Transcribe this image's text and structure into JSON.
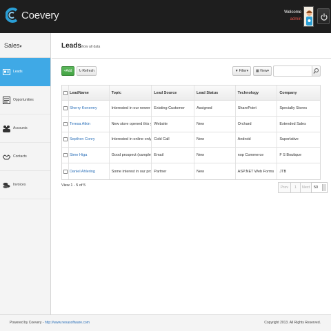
{
  "header": {
    "brand": "Coevery",
    "welcome_label": "Welcome",
    "username": "admin",
    "colors": {
      "background": "#1e1e1e",
      "logo_accent": "#2a9fd6",
      "username": "#e8574c"
    }
  },
  "sidebar": {
    "app_selector": "Sales",
    "items": [
      {
        "label": "Leads",
        "icon": "leads-card-icon",
        "active": true
      },
      {
        "label": "Opportunities",
        "icon": "opportunities-doc-icon",
        "active": false
      },
      {
        "label": "Accounts",
        "icon": "accounts-people-icon",
        "active": false
      },
      {
        "label": "Contacts",
        "icon": "contacts-handshake-icon",
        "active": false
      },
      {
        "label": "Invoices",
        "icon": "invoices-coins-icon",
        "active": false
      }
    ]
  },
  "page": {
    "title": "Leads",
    "subtitle": "show all data"
  },
  "toolbar": {
    "add_label": "Add",
    "refresh_label": "Refresh",
    "filter_label": "Filter",
    "view_label": "View",
    "search_placeholder": ""
  },
  "table": {
    "columns": [
      "LeadName",
      "Topic",
      "Lead Source",
      "Lead Status",
      "Technology",
      "Company"
    ],
    "rows": [
      {
        "name": "Sherry Konermy",
        "topic": "Interested in our newer ...",
        "source": "Existing Customer",
        "status": "Assigned",
        "technology": "SharePoint",
        "company": "Specialty Stores"
      },
      {
        "name": "Teresa Atkin",
        "topic": "New store opened this y...",
        "source": "Website",
        "status": "New",
        "technology": "Orchard",
        "company": "Extended Sales"
      },
      {
        "name": "Septhen Conry",
        "topic": "Interested in online only ...",
        "source": "Cold Call",
        "status": "New",
        "technology": "Android",
        "company": "Superlative"
      },
      {
        "name": "Sime Higa",
        "topic": "Good prospect (sample)",
        "source": "Email",
        "status": "New",
        "technology": "nop Commerce",
        "company": "F S Boutique"
      },
      {
        "name": "Daniel Ahlering",
        "topic": "Some interest in our pro...",
        "source": "Partner",
        "status": "New",
        "technology": "ASP.NET Web Forms",
        "company": "JTB"
      }
    ],
    "view_count": "View 1 - 5 of 5"
  },
  "pager": {
    "prev": "Prev",
    "page": "1",
    "next": "Next",
    "last": "»",
    "page_size": "50"
  },
  "footer": {
    "powered_by": "Powered by Coevery - ",
    "url": "http://www.nexasoftware.com",
    "copyright": "Copyright 2013. All Rights Reserved."
  }
}
